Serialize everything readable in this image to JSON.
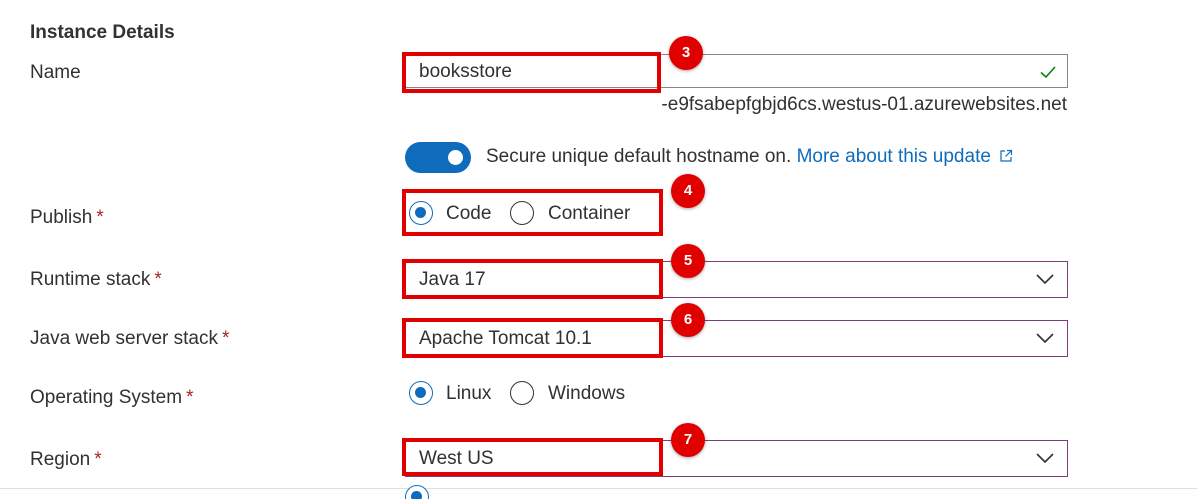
{
  "section_title": "Instance Details",
  "name": {
    "label": "Name",
    "value": "booksstore",
    "hostname_suffix": "-e9fsabepfgbjd6cs.westus-01.azurewebsites.net",
    "valid_icon": "checkmark-icon"
  },
  "secure_hostname": {
    "enabled": true,
    "text": "Secure unique default hostname on.",
    "link_text": "More about this update",
    "link_icon": "external-link-icon"
  },
  "publish": {
    "label": "Publish",
    "required": "*",
    "options": [
      {
        "label": "Code",
        "selected": true
      },
      {
        "label": "Container",
        "selected": false
      }
    ]
  },
  "runtime_stack": {
    "label": "Runtime stack",
    "required": "*",
    "value": "Java 17"
  },
  "java_web_server_stack": {
    "label": "Java web server stack",
    "required": "*",
    "value": "Apache Tomcat 10.1"
  },
  "operating_system": {
    "label": "Operating System",
    "required": "*",
    "options": [
      {
        "label": "Linux",
        "selected": true
      },
      {
        "label": "Windows",
        "selected": false
      }
    ]
  },
  "region": {
    "label": "Region",
    "required": "*",
    "value": "West US"
  },
  "annotations": [
    "3",
    "4",
    "5",
    "6",
    "7"
  ],
  "colors": {
    "accent": "#0f6cbd",
    "required": "#a4262c",
    "annotation_red": "#e00000",
    "valid_green": "#107c10",
    "dropdown_border": "#7b3f7d"
  }
}
